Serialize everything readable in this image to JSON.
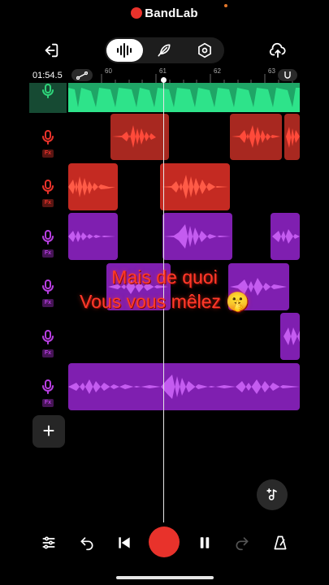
{
  "app": {
    "name": "BandLab",
    "accent": "#e8322b"
  },
  "header": {
    "back_icon": "exit-icon",
    "view_modes": [
      "waveform-icon",
      "feather-icon",
      "hexagon-settings-icon"
    ],
    "active_mode": "waveform-icon",
    "upload_icon": "cloud-upload-icon"
  },
  "timeline": {
    "time_display": "01:54.5",
    "bars": [
      "60",
      "61",
      "62",
      "63"
    ],
    "automation_icon": "automation-icon",
    "snap_icon": "magnet-icon"
  },
  "tracks": [
    {
      "type": "mic",
      "color": "#2ed47a",
      "fx": false
    },
    {
      "type": "mic",
      "color": "#e8322b",
      "fx": true,
      "fx_label": "Fx"
    },
    {
      "type": "mic",
      "color": "#e8322b",
      "fx": true,
      "fx_label": "Fx"
    },
    {
      "type": "mic",
      "color": "#b73ee0",
      "fx": true,
      "fx_label": "Fx"
    },
    {
      "type": "mic",
      "color": "#b73ee0",
      "fx": true,
      "fx_label": "Fx"
    },
    {
      "type": "mic",
      "color": "#b73ee0",
      "fx": true,
      "fx_label": "Fx"
    },
    {
      "type": "mic",
      "color": "#b73ee0",
      "fx": true,
      "fx_label": "Fx"
    }
  ],
  "caption": {
    "line1": "Mais de quoi",
    "line2": "Vous vous mêlez 🤫"
  },
  "add_track": "+",
  "transport": {
    "mixer_icon": "sliders-icon",
    "undo_icon": "undo-icon",
    "to_start_icon": "skip-back-icon",
    "record_icon": "record-icon",
    "pause_icon": "pause-icon",
    "redo_icon": "redo-icon",
    "metronome_icon": "metronome-icon"
  },
  "fab_icon": "add-music-icon"
}
